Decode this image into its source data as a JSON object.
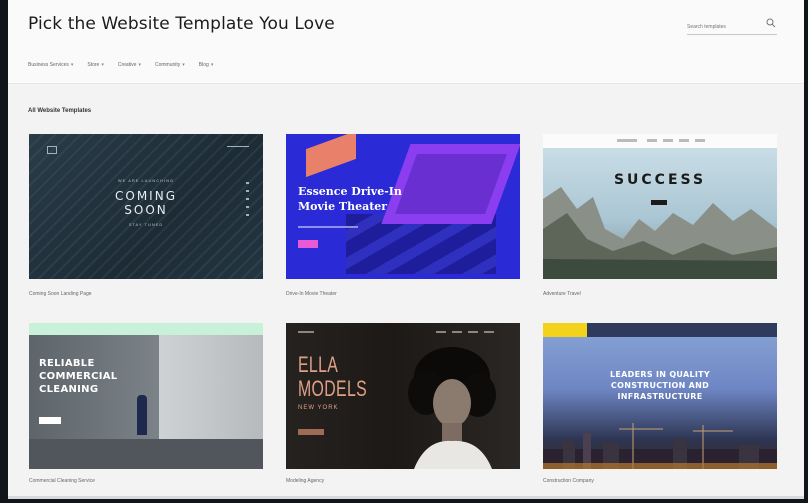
{
  "header": {
    "title": "Pick the Website Template You Love",
    "search_placeholder": "Search templates"
  },
  "filters": [
    {
      "label": "Business Services"
    },
    {
      "label": "Store"
    },
    {
      "label": "Creative"
    },
    {
      "label": "Community"
    },
    {
      "label": "Blog"
    }
  ],
  "section": {
    "title": "All Website Templates"
  },
  "templates": [
    {
      "caption": "Coming Soon Landing Page",
      "thumb": {
        "pre": "WE ARE LAUNCHING",
        "headline_1": "COMING",
        "headline_2": "SOON",
        "post": "STAY TUNED"
      }
    },
    {
      "caption": "Drive-In Movie Theater",
      "thumb": {
        "headline_1": "Essence Drive-In",
        "headline_2": "Movie Theater"
      }
    },
    {
      "caption": "Adventure Travel",
      "thumb": {
        "headline": "SUCCESS"
      }
    },
    {
      "caption": "Commercial Cleaning Service",
      "thumb": {
        "headline_1": "RELIABLE",
        "headline_2": "COMMERCIAL",
        "headline_3": "CLEANING"
      }
    },
    {
      "caption": "Modeling Agency",
      "thumb": {
        "headline_1": "ELLA",
        "headline_2": "MODELS",
        "sub": "NEW YORK"
      }
    },
    {
      "caption": "Construction Company",
      "thumb": {
        "headline_1": "LEADERS IN QUALITY",
        "headline_2": "CONSTRUCTION AND",
        "headline_3": "INFRASTRUCTURE"
      }
    }
  ],
  "colors": {
    "page_bg": "#f3f3f4",
    "frame_bg": "#10151b"
  }
}
